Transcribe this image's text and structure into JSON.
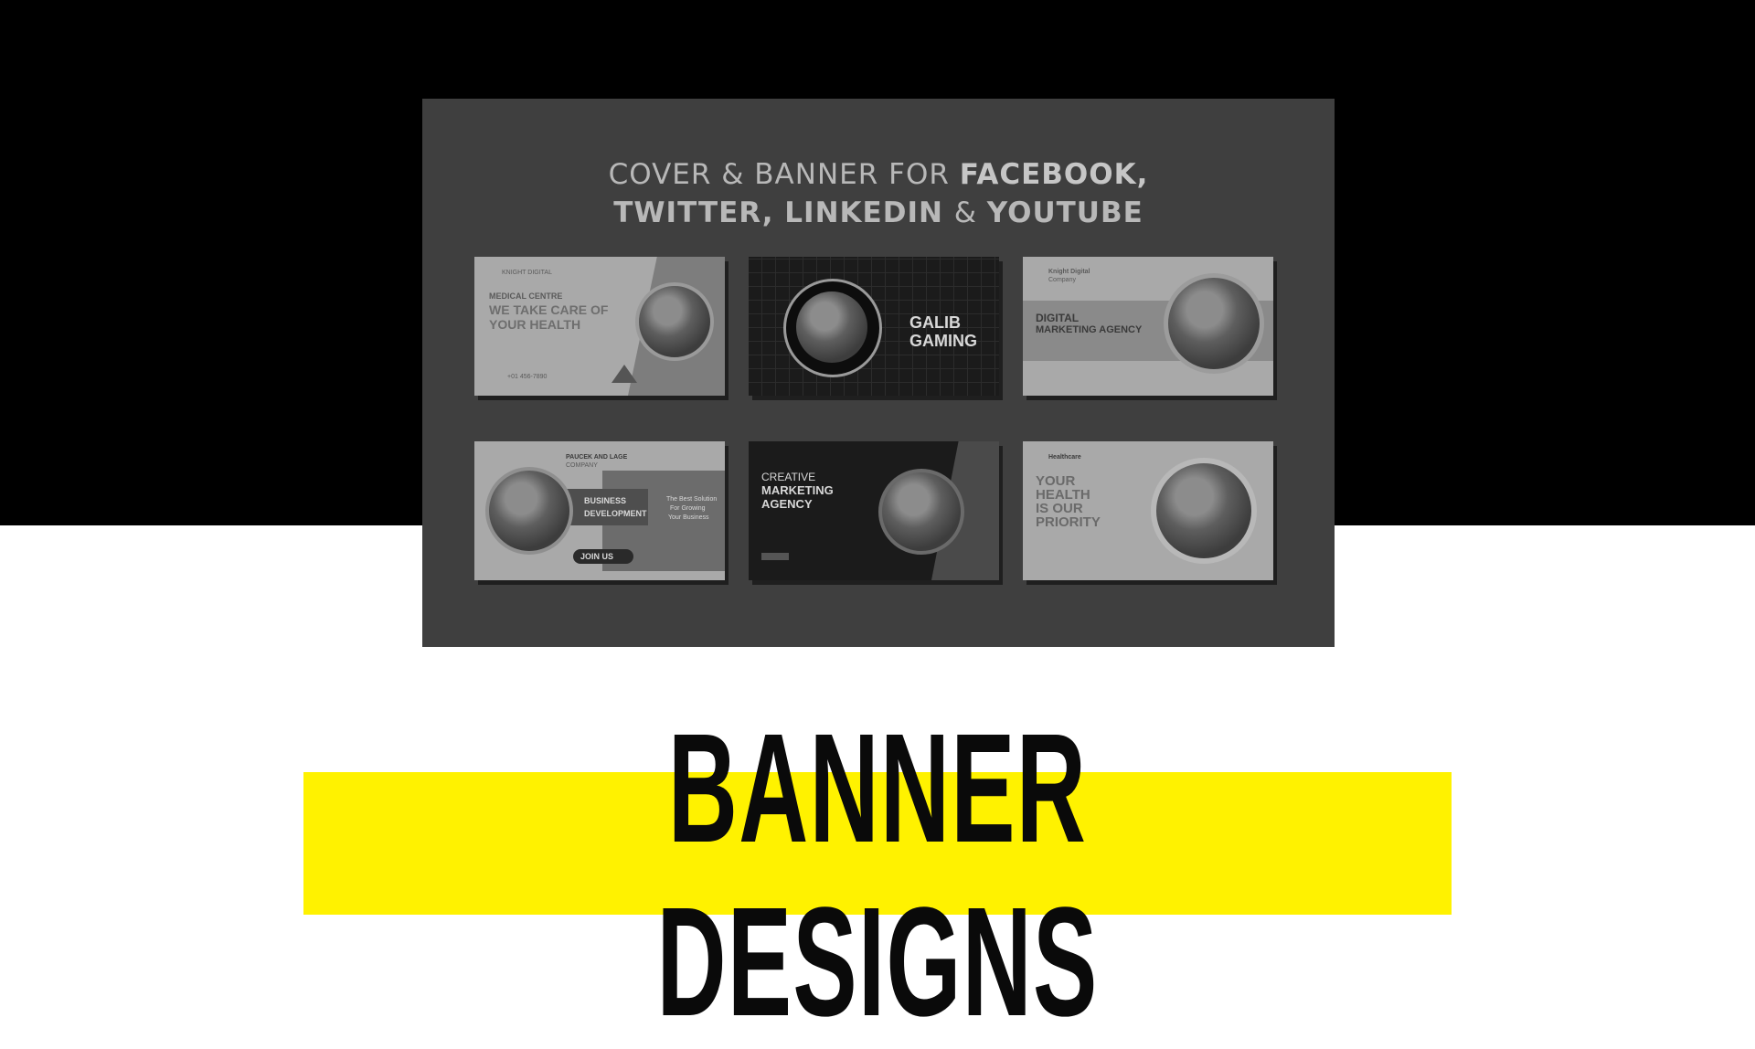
{
  "preview": {
    "headline_line1_plain": "COVER & BANNER  FOR ",
    "headline_line1_bold": "FACEBOOK,",
    "headline_line2_a": "TWITTER, LINKEDIN ",
    "headline_line2_amp": "& ",
    "headline_line2_b": "YOUTUBE"
  },
  "cards": {
    "medical": {
      "brand": "KNIGHT DIGITAL",
      "kicker": "MEDICAL CENTRE",
      "headline1": "WE TAKE CARE OF",
      "headline2": "YOUR HEALTH",
      "phone": "+01 456-7890"
    },
    "gaming": {
      "line1": "GALIB",
      "line2": "GAMING"
    },
    "digital": {
      "brand": "Knight Digital",
      "brand_sub": "Company",
      "line1": "DIGITAL",
      "line2": "MARKETING AGENCY"
    },
    "business": {
      "company": "PAUCEK AND LAGE",
      "company_sub": "COMPANY",
      "line1": "BUSINESS",
      "line2": "DEVELOPMENT",
      "side1": "The Best Solution",
      "side2": "For Growing",
      "side3": "Your Business",
      "cta": "JOIN US"
    },
    "creative": {
      "line1": "CREATIVE",
      "line2": "MARKETING",
      "line3": "AGENCY"
    },
    "healthcare": {
      "brand": "Healthcare",
      "line1": "YOUR",
      "line2": "HEALTH",
      "line3": "IS OUR",
      "line4": "PRIORITY"
    }
  },
  "title": "BANNER DESIGNS",
  "colors": {
    "accent": "#fff200",
    "top_band": "#000000",
    "panel": "#3f3f3f"
  }
}
